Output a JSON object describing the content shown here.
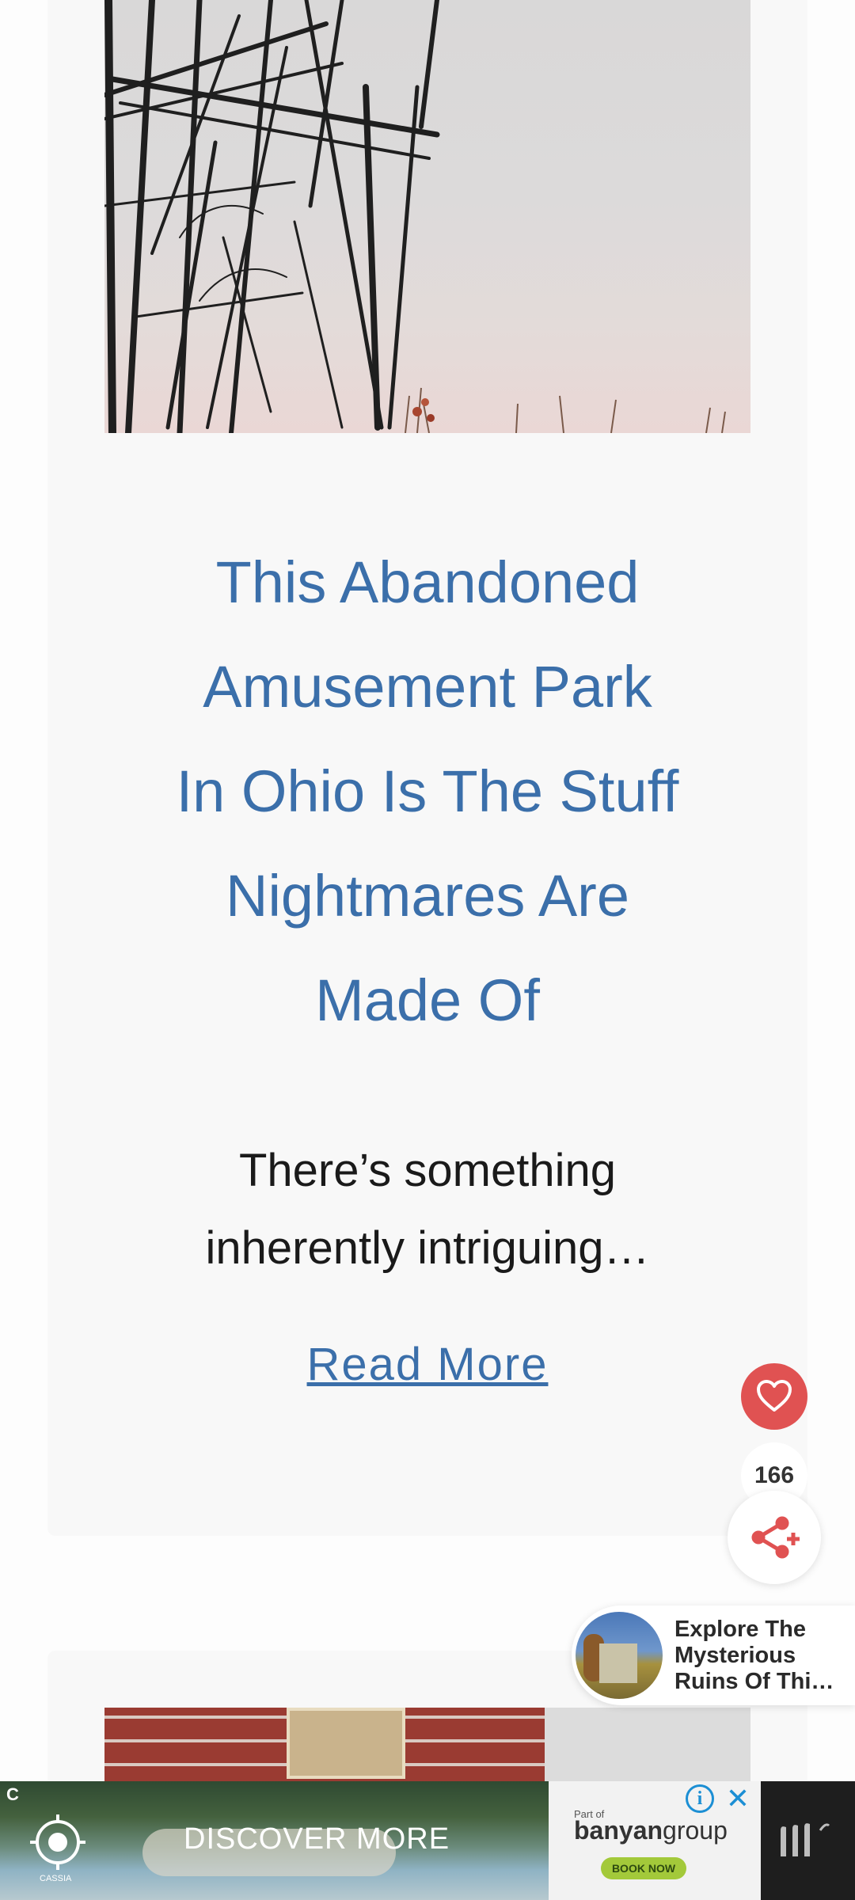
{
  "article": {
    "title": "This Abandoned Amusement Park In Ohio Is The Stuff Nightmares Are Made Of",
    "title_lines": [
      "This Abandoned",
      "Amusement Park",
      "In Ohio Is The Stuff",
      "Nightmares Are",
      "Made Of"
    ],
    "excerpt_lines": [
      "There’s something",
      "inherently intriguing…"
    ],
    "read_more": "Read More"
  },
  "social": {
    "share_count": "166",
    "heart_icon": "heart-icon",
    "share_icon": "share-icon"
  },
  "recommendation": {
    "lines": [
      "Explore The",
      "Mysterious",
      "Ruins Of Thi…"
    ]
  },
  "ad": {
    "corner_label": "C",
    "logo_caption": "CASSIA",
    "cta": "DISCOVER MORE",
    "brand_part_of": "Part of",
    "brand_name_bold": "banyan",
    "brand_name_light": "group",
    "book_now": "BOOK NOW",
    "info_label": "i",
    "close_label": "✕"
  },
  "colors": {
    "link_blue": "#3b6faa",
    "accent_red": "#e05252",
    "card_bg": "#f8f8f8"
  }
}
